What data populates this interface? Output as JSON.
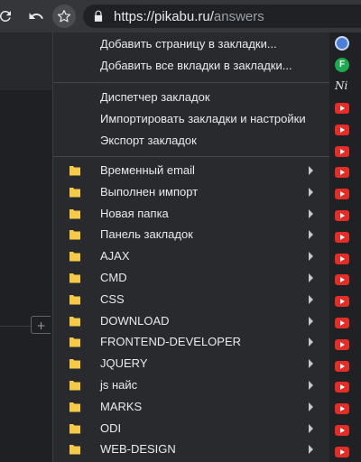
{
  "toolbar": {
    "reload_icon": "reload-icon",
    "back_icon": "undo-icon",
    "star_icon": "star-icon",
    "url_host": "https://pikabu.ru/",
    "url_path": "answers"
  },
  "menu": {
    "actions_top": [
      {
        "label": "Добавить страницу в закладки..."
      },
      {
        "label": "Добавить все вкладки в закладки..."
      }
    ],
    "actions_mid": [
      {
        "label": "Диспетчер закладок"
      },
      {
        "label": "Импортировать закладки и настройки"
      },
      {
        "label": "Экспорт закладок"
      }
    ],
    "folders": [
      {
        "label": "Временный email"
      },
      {
        "label": "Выполнен импорт"
      },
      {
        "label": "Новая папка"
      },
      {
        "label": "Панель закладок"
      },
      {
        "label": "AJAX"
      },
      {
        "label": "CMD"
      },
      {
        "label": "CSS"
      },
      {
        "label": "DOWNLOAD"
      },
      {
        "label": "FRONTEND-DEVELOPER"
      },
      {
        "label": "JQUERY"
      },
      {
        "label": "js найс"
      },
      {
        "label": "MARKS"
      },
      {
        "label": "ODI"
      },
      {
        "label": "WEB-DESIGN"
      }
    ]
  },
  "extensions": {
    "icons": [
      "o-badge-icon",
      "green-f-icon",
      "ni-icon",
      "youtube-icon"
    ],
    "colors": {
      "youtube": "#e52d27",
      "green": "#1da851",
      "blue": "#4a7fd6"
    }
  },
  "page": {
    "add_button": "+"
  }
}
